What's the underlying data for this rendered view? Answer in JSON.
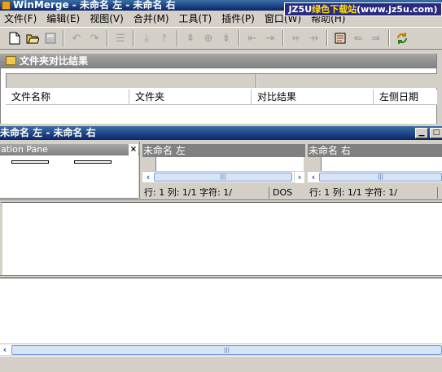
{
  "window": {
    "title": "WinMerge - 未命名 左 - 未命名 右"
  },
  "watermark": {
    "brand": "JZ5U",
    "text": "绿色下载站",
    "url": "(www.jz5u.com)"
  },
  "menu": [
    {
      "label": "文件(F)"
    },
    {
      "label": "编辑(E)"
    },
    {
      "label": "视图(V)"
    },
    {
      "label": "合并(M)"
    },
    {
      "label": "工具(T)"
    },
    {
      "label": "插件(P)"
    },
    {
      "label": "窗口(W)"
    },
    {
      "label": "帮助(H)"
    }
  ],
  "toolbar": {
    "icons": [
      "new-icon",
      "open-folder-icon",
      "save-icon",
      "undo-icon",
      "redo-icon",
      "diff-align-icon",
      "next-diff-icon",
      "prev-diff-icon",
      "first-diff-icon",
      "current-diff-icon",
      "last-diff-icon",
      "copy-left-icon",
      "copy-right-icon",
      "copy-left-advance-icon",
      "copy-right-advance-icon",
      "options-icon",
      "copy-all-left-icon",
      "copy-all-right-icon",
      "refresh-icon"
    ]
  },
  "folder_compare": {
    "title": "文件夹对比结果",
    "columns": [
      "文件名称",
      "文件夹",
      "对比结果",
      "左侧日期"
    ]
  },
  "file_compare": {
    "title": "未命名 左 - 未命名 右",
    "location_pane": {
      "title": "ation Pane",
      "close_label": "×"
    },
    "left_pane": {
      "header": "未命名 左",
      "status": {
        "line": "行: 1",
        "column": "列: 1/1",
        "chars": "字符: 1/",
        "eol": "DOS"
      }
    },
    "right_pane": {
      "header": "未命名 右",
      "status": {
        "line": "行: 1",
        "column": "列: 1/1",
        "chars": "字符: 1/"
      }
    }
  },
  "colors": {
    "title_active": "#0a246a",
    "title_inactive": "#808080",
    "face": "#d4d0c8"
  }
}
